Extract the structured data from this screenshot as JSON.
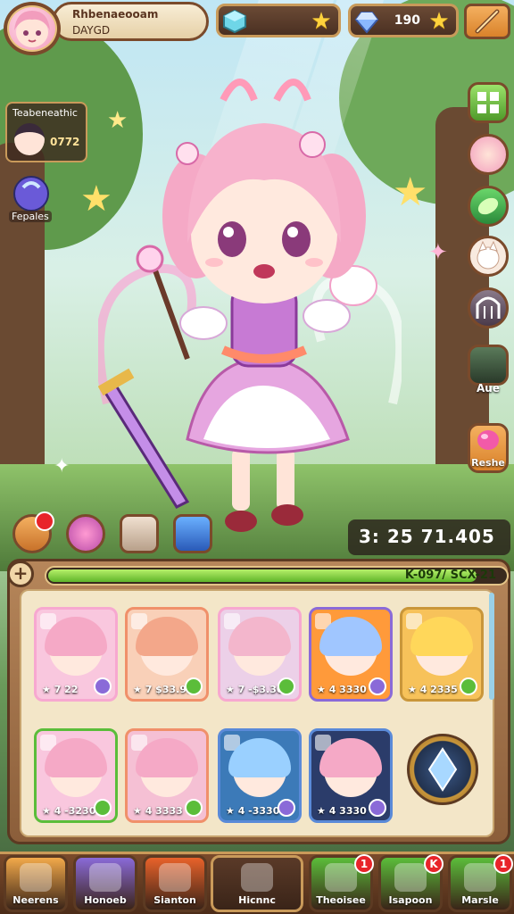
{
  "player": {
    "name": "Rhbenaeooam",
    "sub": "DAYGD"
  },
  "resources": {
    "gems_value": "",
    "crystals_value": "190"
  },
  "side_widgets": {
    "friend_title": "Teabeneathic",
    "friend_value": "0772",
    "potion_label": "Fepales"
  },
  "right_column": {
    "label_1": "Aue",
    "label_2": "Reshe"
  },
  "power": {
    "value": "3: 25 71.405"
  },
  "exp": {
    "label": "K-097/ SCX-21",
    "fill": 0.93
  },
  "cards": [
    {
      "lvl": "7 22",
      "frame": "#f7a8d0",
      "hair": "#f5a9c6",
      "badge": "#8a6ad8",
      "bg": "#f9c7de"
    },
    {
      "lvl": "7 $33.95",
      "frame": "#f0906a",
      "hair": "#f3a78a",
      "badge": "#5bbd3a",
      "bg": "#f9d0b8"
    },
    {
      "lvl": "7 -$3.30",
      "frame": "#f7a8d0",
      "hair": "#f3b6cc",
      "badge": "#5bbd3a",
      "bg": "#ecd0e8"
    },
    {
      "lvl": "4 3330",
      "frame": "#8a6ad8",
      "hair": "#a0c6ff",
      "badge": "#8a6ad8",
      "bg": "#ff9a3a"
    },
    {
      "lvl": "4 2335",
      "frame": "#c9963a",
      "hair": "#ffd75a",
      "badge": "#5bbd3a",
      "bg": "#f7c25a"
    },
    {
      "lvl": "4 -3230",
      "frame": "#5bbd3a",
      "hair": "#f5a9c6",
      "badge": "#5bbd3a",
      "bg": "#f9c7de"
    },
    {
      "lvl": "4 3333",
      "frame": "#f0906a",
      "hair": "#f5a9c6",
      "badge": "#5bbd3a",
      "bg": "#f5c0d4"
    },
    {
      "lvl": "4 -3330",
      "frame": "#5a8ad8",
      "hair": "#9ad0ff",
      "badge": "#8a6ad8",
      "bg": "#3c7ab8"
    },
    {
      "lvl": "4 3330",
      "frame": "#5a8ad8",
      "hair": "#f5a9c6",
      "badge": "#8a6ad8",
      "bg": "#2b3c6a"
    }
  ],
  "nav": {
    "items": [
      {
        "label": "Neerens",
        "icon": "home-icon",
        "color": "#f2a94a",
        "notif": ""
      },
      {
        "label": "Honoeb",
        "icon": "pencil-icon",
        "color": "#8a6ad8",
        "notif": ""
      },
      {
        "label": "Sianton",
        "icon": "crystal-icon",
        "color": "#e8622a",
        "notif": ""
      },
      {
        "label": "Hicnnc",
        "icon": "arrow-icon",
        "color": "#3a2418",
        "notif": ""
      },
      {
        "label": "Theoisee",
        "icon": "list-icon",
        "color": "#5bbd3a",
        "notif": "1"
      },
      {
        "label": "Isapoon",
        "icon": "carrot-icon",
        "color": "#5bbd3a",
        "notif": "K"
      },
      {
        "label": "Marsle",
        "icon": "flower-icon",
        "color": "#5bbd3a",
        "notif": "1"
      }
    ]
  },
  "colors": {
    "accent": "#c99a5a",
    "wood": "#7a4a2b"
  }
}
